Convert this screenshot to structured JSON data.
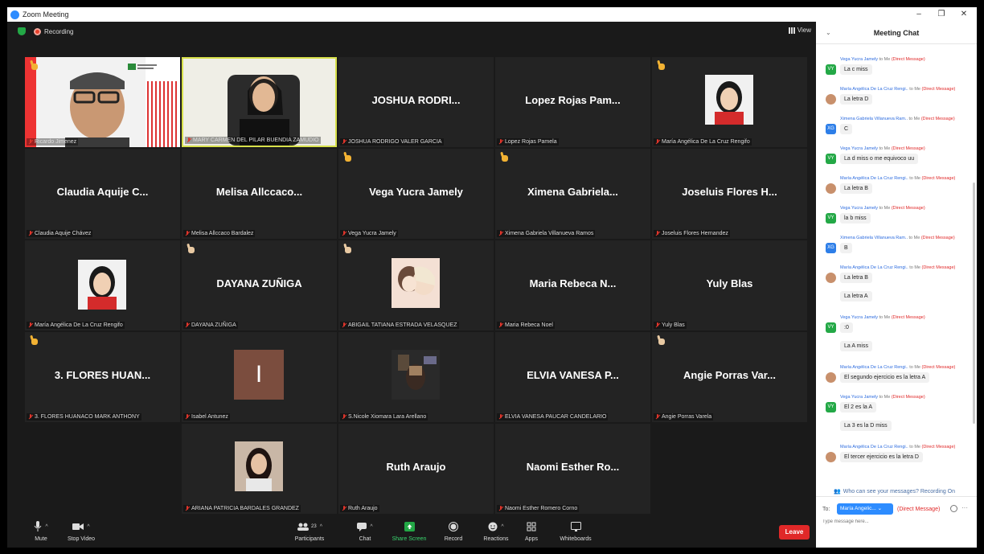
{
  "window": {
    "title": "Zoom Meeting",
    "controls": [
      "–",
      "❐",
      "✕"
    ]
  },
  "topbar": {
    "recording_label": "Recording",
    "view_label": "View"
  },
  "tiles": [
    {
      "caption": "Ricardo Jimenez",
      "big": "",
      "kind": "video-ricardo",
      "hand": true,
      "hand_style": "gold"
    },
    {
      "caption": "MARY CARMEN DEL PILAR BUENDIA ZAMUDIO",
      "big": "",
      "kind": "video-mary",
      "active": true
    },
    {
      "caption": "JOSHUA RODRIGO VALER GARCIA",
      "big": "JOSHUA RODRI..."
    },
    {
      "caption": "Lopez Rojas Pamela",
      "big": "Lopez Rojas Pam..."
    },
    {
      "caption": "María Angélica De La Cruz Rengifo",
      "big": "",
      "kind": "photo-girl",
      "hand": true,
      "hand_style": "gold"
    },
    {
      "caption": "Claudia Aquije Chávez",
      "big": "Claudia Aquije C..."
    },
    {
      "caption": "Melisa Allccaco Bardalez",
      "big": "Melisa Allccaco..."
    },
    {
      "caption": "Vega Yucra Jamely",
      "big": "Vega Yucra Jamely",
      "hand": true,
      "hand_style": "gold"
    },
    {
      "caption": "Ximena Gabriela Villanueva Ramos",
      "big": "Ximena Gabriela...",
      "hand": true,
      "hand_style": "gold"
    },
    {
      "caption": "Joseluis Flores Hernandez",
      "big": "Joseluis Flores H..."
    },
    {
      "caption": "María Angélica De La Cruz Rengifo",
      "big": "",
      "kind": "photo-girl"
    },
    {
      "caption": "DAYANA ZUÑIGA",
      "big": "DAYANA ZUÑIGA",
      "hand": true,
      "hand_style": "light"
    },
    {
      "caption": "ABIGAIL TATIANA ESTRADA VELASQUEZ",
      "big": "",
      "kind": "photo-anime",
      "hand": true,
      "hand_style": "light"
    },
    {
      "caption": "Maria Rebeca Noel",
      "big": "Maria Rebeca N..."
    },
    {
      "caption": "Yuly Blas",
      "big": "Yuly Blas"
    },
    {
      "caption": "3. FLORES HUANACO MARK ANTHONY",
      "big": "3. FLORES HUAN...",
      "hand": true,
      "hand_style": "gold"
    },
    {
      "caption": "Isabel Antunez",
      "big": "",
      "kind": "initial",
      "initial": "I"
    },
    {
      "caption": "S.Nicole Xiomara Lara Arellano",
      "big": "",
      "kind": "photo-nicole"
    },
    {
      "caption": "ELVIA VANESA PAUCAR CANDELARIO",
      "big": "ELVIA VANESA P..."
    },
    {
      "caption": "Angie Porras Varela",
      "big": "Angie Porras Var...",
      "hand": true,
      "hand_style": "light"
    },
    {
      "caption": "ARIANA PATRICIA BARDALES GRANDEZ",
      "big": "",
      "kind": "photo-ariana"
    },
    {
      "caption": "Ruth Araujo",
      "big": "Ruth Araujo"
    },
    {
      "caption": "Naomi Esther Romero Corno",
      "big": "Naomi Esther Ro..."
    }
  ],
  "toolbar": {
    "mute": "Mute",
    "stop_video": "Stop Video",
    "participants": "Participants",
    "participants_count": "23",
    "chat": "Chat",
    "share_screen": "Share Screen",
    "record": "Record",
    "reactions": "Reactions",
    "apps": "Apps",
    "whiteboards": "Whiteboards",
    "leave": "Leave"
  },
  "chat": {
    "title": "Meeting Chat",
    "messages": [
      {
        "from": "Vega Yucra Jamely",
        "to": "to Me",
        "dm": "(Direct Message)",
        "avatar": "VY",
        "text": "La c miss"
      },
      {
        "from": "María Angélica De La Cruz Rengi..",
        "to": "to Me",
        "dm": "(Direct Message)",
        "avatar": "MA",
        "text": "La letra D"
      },
      {
        "from": "Ximena Gabriela Villanueva Ram..",
        "to": "to Me",
        "dm": "(Direct Message)",
        "avatar": "XG",
        "text": "C"
      },
      {
        "from": "Vega Yucra Jamely",
        "to": "to Me",
        "dm": "(Direct Message)",
        "avatar": "VY",
        "text": "La d miss o me equivoco uu"
      },
      {
        "from": "María Angélica De La Cruz Rengi..",
        "to": "to Me",
        "dm": "(Direct Message)",
        "avatar": "MA",
        "text": "La letra B"
      },
      {
        "from": "Vega Yucra Jamely",
        "to": "to Me",
        "dm": "(Direct Message)",
        "avatar": "VY",
        "text": "la b miss"
      },
      {
        "from": "Ximena Gabriela Villanueva Ram..",
        "to": "to Me",
        "dm": "(Direct Message)",
        "avatar": "XG",
        "text": "B"
      },
      {
        "from": "María Angélica De La Cruz Rengi..",
        "to": "to Me",
        "dm": "(Direct Message)",
        "avatar": "MA",
        "text": "La letra B",
        "extra": "La letra A"
      },
      {
        "from": "Vega Yucra Jamely",
        "to": "to Me",
        "dm": "(Direct Message)",
        "avatar": "VY",
        "text": ":0",
        "extra": "La A miss"
      },
      {
        "from": "María Angélica De La Cruz Rengi..",
        "to": "to Me",
        "dm": "(Direct Message)",
        "avatar": "MA",
        "text": "El segundo ejercicio es la letra A"
      },
      {
        "from": "Vega Yucra Jamely",
        "to": "to Me",
        "dm": "(Direct Message)",
        "avatar": "VY",
        "text": "El 2 es la A",
        "extra": "La 3 es la D miss"
      },
      {
        "from": "María Angélica De La Cruz Rengi..",
        "to": "to Me",
        "dm": "(Direct Message)",
        "avatar": "MA",
        "text": "El tercer ejercicio es la letra D"
      }
    ],
    "who_can_see": "Who can see your messages? Recording On",
    "to_label": "To:",
    "to_recipient": "María Angelic...",
    "to_dm": "(Direct Message)",
    "input_placeholder": "Type message here..."
  }
}
